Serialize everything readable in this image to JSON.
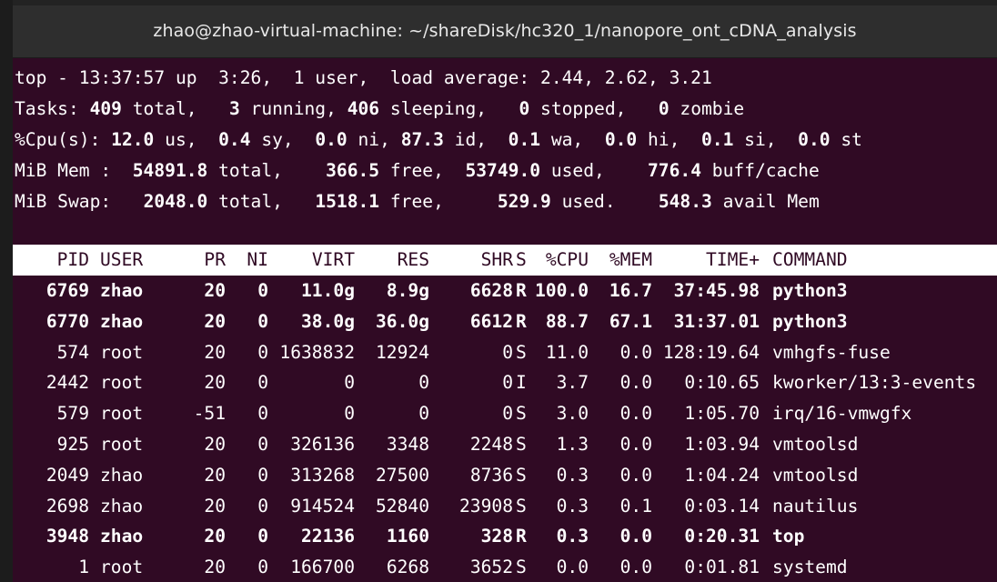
{
  "window": {
    "title": "zhao@zhao-virtual-machine: ~/shareDisk/hc320_1/nanopore_ont_cDNA_analysis"
  },
  "colors": {
    "terminal_bg": "#300a24",
    "titlebar_bg": "#2e2e2e",
    "header_bg": "#ffffff",
    "text": "#ffffff"
  },
  "summary": {
    "line1": "top - 13:37:57 up  3:26,  1 user,  load average: 2.44, 2.62, 3.21",
    "tasks": {
      "label": "Tasks: ",
      "total": "409",
      "total_l": " total,   ",
      "running": "3",
      "running_l": " running, ",
      "sleeping": "406",
      "sleeping_l": " sleeping,   ",
      "stopped": "0",
      "stopped_l": " stopped,   ",
      "zombie": "0",
      "zombie_l": " zombie"
    },
    "cpu": {
      "label": "%Cpu(s): ",
      "us": "12.0",
      "us_l": " us,  ",
      "sy": "0.4",
      "sy_l": " sy,  ",
      "ni": "0.0",
      "ni_l": " ni, ",
      "id": "87.3",
      "id_l": " id,  ",
      "wa": "0.1",
      "wa_l": " wa,  ",
      "hi": "0.0",
      "hi_l": " hi,  ",
      "si": "0.1",
      "si_l": " si,  ",
      "st": "0.0",
      "st_l": " st"
    },
    "mem": {
      "label": "MiB Mem :  ",
      "total": "54891.8",
      "total_l": " total,    ",
      "free": "366.5",
      "free_l": " free,  ",
      "used": "53749.0",
      "used_l": " used,    ",
      "cache": "776.4",
      "cache_l": " buff/cache"
    },
    "swap": {
      "label": "MiB Swap:   ",
      "total": "2048.0",
      "total_l": " total,   ",
      "free": "1518.1",
      "free_l": " free,     ",
      "used": "529.9",
      "used_l": " used.    ",
      "avail": "548.3",
      "avail_l": " avail Mem"
    }
  },
  "columns": [
    "PID",
    "USER",
    "PR",
    "NI",
    "VIRT",
    "RES",
    "SHR",
    "S",
    "%CPU",
    "%MEM",
    "TIME+",
    "COMMAND"
  ],
  "processes": [
    {
      "pid": "6769",
      "user": "zhao",
      "pr": "20",
      "ni": "0",
      "virt": "11.0g",
      "res": "8.9g",
      "shr": "6628",
      "s": "R",
      "cpu": "100.0",
      "mem": "16.7",
      "time": "37:45.98",
      "cmd": "python3",
      "bold": true
    },
    {
      "pid": "6770",
      "user": "zhao",
      "pr": "20",
      "ni": "0",
      "virt": "38.0g",
      "res": "36.0g",
      "shr": "6612",
      "s": "R",
      "cpu": "88.7",
      "mem": "67.1",
      "time": "31:37.01",
      "cmd": "python3",
      "bold": true
    },
    {
      "pid": "574",
      "user": "root",
      "pr": "20",
      "ni": "0",
      "virt": "1638832",
      "res": "12924",
      "shr": "0",
      "s": "S",
      "cpu": "11.0",
      "mem": "0.0",
      "time": "128:19.64",
      "cmd": "vmhgfs-fuse",
      "bold": false
    },
    {
      "pid": "2442",
      "user": "root",
      "pr": "20",
      "ni": "0",
      "virt": "0",
      "res": "0",
      "shr": "0",
      "s": "I",
      "cpu": "3.7",
      "mem": "0.0",
      "time": "0:10.65",
      "cmd": "kworker/13:3-events",
      "bold": false
    },
    {
      "pid": "579",
      "user": "root",
      "pr": "-51",
      "ni": "0",
      "virt": "0",
      "res": "0",
      "shr": "0",
      "s": "S",
      "cpu": "3.0",
      "mem": "0.0",
      "time": "1:05.70",
      "cmd": "irq/16-vmwgfx",
      "bold": false
    },
    {
      "pid": "925",
      "user": "root",
      "pr": "20",
      "ni": "0",
      "virt": "326136",
      "res": "3348",
      "shr": "2248",
      "s": "S",
      "cpu": "1.3",
      "mem": "0.0",
      "time": "1:03.94",
      "cmd": "vmtoolsd",
      "bold": false
    },
    {
      "pid": "2049",
      "user": "zhao",
      "pr": "20",
      "ni": "0",
      "virt": "313268",
      "res": "27500",
      "shr": "8736",
      "s": "S",
      "cpu": "0.3",
      "mem": "0.0",
      "time": "1:04.24",
      "cmd": "vmtoolsd",
      "bold": false
    },
    {
      "pid": "2698",
      "user": "zhao",
      "pr": "20",
      "ni": "0",
      "virt": "914524",
      "res": "52840",
      "shr": "23908",
      "s": "S",
      "cpu": "0.3",
      "mem": "0.1",
      "time": "0:03.14",
      "cmd": "nautilus",
      "bold": false
    },
    {
      "pid": "3948",
      "user": "zhao",
      "pr": "20",
      "ni": "0",
      "virt": "22136",
      "res": "1160",
      "shr": "328",
      "s": "R",
      "cpu": "0.3",
      "mem": "0.0",
      "time": "0:20.31",
      "cmd": "top",
      "bold": true
    },
    {
      "pid": "1",
      "user": "root",
      "pr": "20",
      "ni": "0",
      "virt": "166700",
      "res": "6268",
      "shr": "3652",
      "s": "S",
      "cpu": "0.0",
      "mem": "0.0",
      "time": "0:01.81",
      "cmd": "systemd",
      "bold": false
    }
  ]
}
